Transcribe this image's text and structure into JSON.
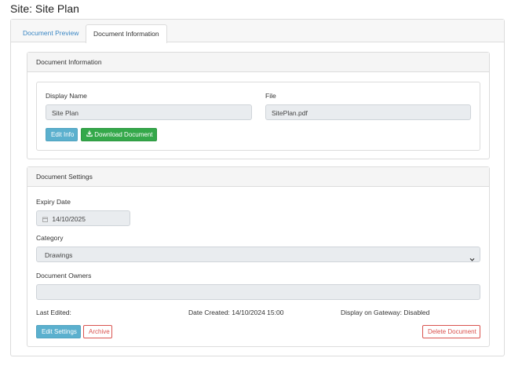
{
  "page": {
    "title": "Site: Site Plan"
  },
  "tabs": [
    {
      "label": "Document Preview",
      "active": false
    },
    {
      "label": "Document Information",
      "active": true
    }
  ],
  "document_info": {
    "heading": "Document Information",
    "display_name_label": "Display Name",
    "display_name_value": "Site Plan",
    "file_label": "File",
    "file_value": "SitePlan.pdf",
    "edit_info_label": "Edit Info",
    "download_label": "Download Document"
  },
  "document_settings": {
    "heading": "Document Settings",
    "expiry_label": "Expiry Date",
    "expiry_value": "14/10/2025",
    "category_label": "Category",
    "category_value": "Drawings",
    "owners_label": "Document Owners",
    "owners_value": "",
    "last_edited": "Last Edited:",
    "date_created": "Date Created: 14/10/2024 15:00",
    "display_on_gateway": "Display on Gateway: Disabled",
    "edit_settings_label": "Edit Settings",
    "archive_label": "Archive",
    "delete_label": "Delete Document"
  },
  "colors": {
    "link": "#3b87c4",
    "info": "#5bb0ce",
    "success": "#34a84a",
    "danger": "#d9534f"
  },
  "icons": {
    "download": "download-icon",
    "calendar": "calendar-icon",
    "dropdown": "chevron-down-icon"
  }
}
